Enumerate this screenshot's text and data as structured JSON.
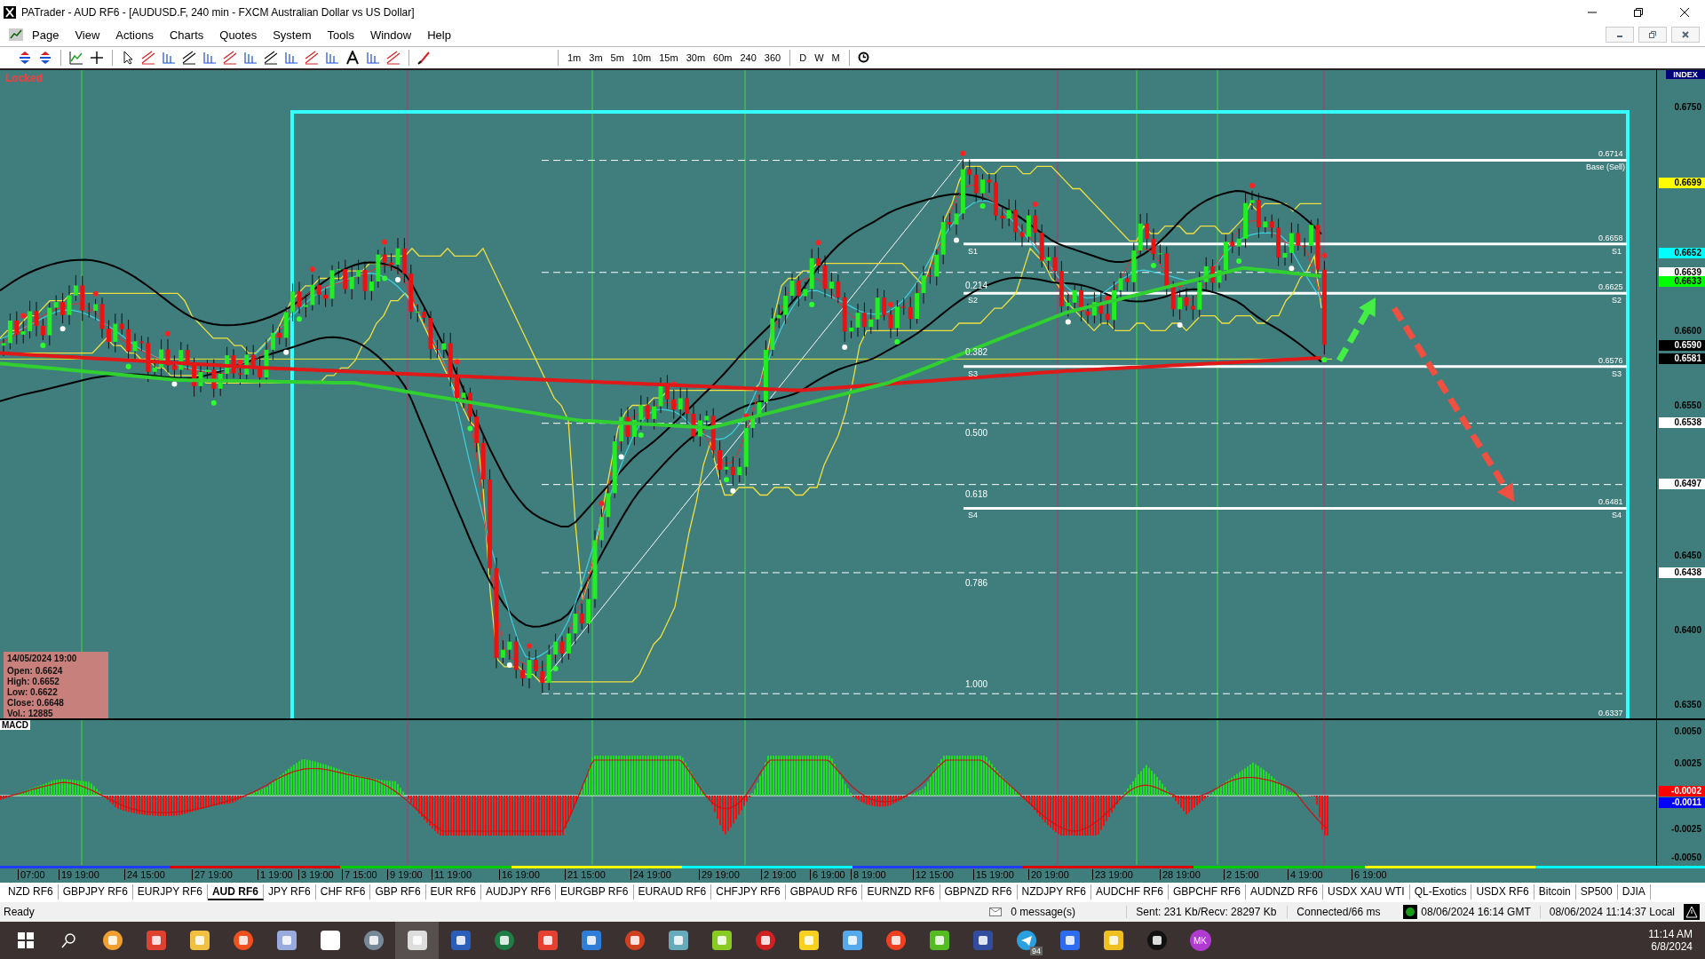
{
  "window": {
    "title": "PATrader - AUD RF6 - [AUDUSD.F, 240 min - FXCM Australian Dollar vs US Dollar]"
  },
  "menu": [
    "Page",
    "View",
    "Actions",
    "Charts",
    "Quotes",
    "System",
    "Tools",
    "Window",
    "Help"
  ],
  "toolbar": {
    "timeframes": [
      "1m",
      "3m",
      "5m",
      "10m",
      "15m",
      "30m",
      "60m",
      "240",
      "360"
    ],
    "periods": [
      "D",
      "W",
      "M"
    ]
  },
  "chart": {
    "status": "Locked",
    "axis_header": "INDEX",
    "price_ticks": [
      "0.6750",
      "0.6600",
      "0.6550",
      "0.6450",
      "0.6400",
      "0.6350"
    ],
    "price_tags": [
      {
        "label": "0.6699",
        "color": "#ffff00"
      },
      {
        "label": "0.6652",
        "color": "#00ffff"
      },
      {
        "label": "0.6639",
        "color": "#ffffff"
      },
      {
        "label": "0.6633",
        "color": "#00ff00"
      },
      {
        "label": "0.6590",
        "color": "#000000"
      },
      {
        "label": "0.6581",
        "color": "#000000"
      },
      {
        "label": "0.6538",
        "color": "#ffffff"
      },
      {
        "label": "0.6497",
        "color": "#ffffff"
      },
      {
        "label": "0.6438",
        "color": "#ffffff"
      }
    ],
    "fib_labels": [
      "0.214",
      "0.382",
      "0.500",
      "0.618",
      "0.786",
      "1.000"
    ],
    "level_labels": [
      "0.6714",
      "Base (Sell)",
      "0.6658",
      "S1",
      "S1",
      "0.6625",
      "S2",
      "S2",
      "0.6576",
      "S3",
      "S3",
      "0.6481",
      "S4",
      "S4",
      "0.6337"
    ],
    "info": {
      "date": "14/05/2024 19:00",
      "lines": [
        "Open: 0.6624",
        "High: 0.6652",
        "Low: 0.6622",
        "Close: 0.6648",
        "Vol.: 12885"
      ]
    }
  },
  "macd": {
    "label": "MACD",
    "ticks": [
      "0.0050",
      "0.0025",
      "-0.0025",
      "-0.0050"
    ],
    "tags": [
      {
        "label": "-0.0002",
        "color": "#ff0000"
      },
      {
        "label": "-0.0011",
        "color": "#0000ff"
      }
    ]
  },
  "time_axis": [
    "07:00",
    "19 19:00",
    "24 15:00",
    "27 19:00",
    "1 19:00",
    "3 19:00",
    "7 15:00",
    "9 19:00",
    "11 19:00",
    "16 19:00",
    "21 15:00",
    "24 19:00",
    "29 19:00",
    "2 19:00",
    "6 19:00",
    "8 19:00",
    "12 15:00",
    "15 19:00",
    "20 19:00",
    "23 19:00",
    "28 19:00",
    "2 15:00",
    "4 19:00",
    "6 19:00"
  ],
  "tabs": [
    {
      "label": "NZD RF6",
      "selected": false
    },
    {
      "label": "GBPJPY RF6",
      "selected": false
    },
    {
      "label": "EURJPY RF6",
      "selected": false
    },
    {
      "label": "AUD RF6",
      "selected": true
    },
    {
      "label": "JPY RF6",
      "selected": false
    },
    {
      "label": "CHF RF6",
      "selected": false
    },
    {
      "label": "GBP RF6",
      "selected": false
    },
    {
      "label": "EUR RF6",
      "selected": false
    },
    {
      "label": "AUDJPY RF6",
      "selected": false
    },
    {
      "label": "EURGBP RF6",
      "selected": false
    },
    {
      "label": "EURAUD RF6",
      "selected": false
    },
    {
      "label": "CHFJPY RF6",
      "selected": false
    },
    {
      "label": "GBPAUD RF6",
      "selected": false
    },
    {
      "label": "EURNZD RF6",
      "selected": false
    },
    {
      "label": "GBPNZD RF6",
      "selected": false
    },
    {
      "label": "NZDJPY RF6",
      "selected": false
    },
    {
      "label": "AUDCHF RF6",
      "selected": false
    },
    {
      "label": "GBPCHF RF6",
      "selected": false
    },
    {
      "label": "AUDNZD RF6",
      "selected": false
    },
    {
      "label": "USDX XAU WTI",
      "selected": false
    },
    {
      "label": "QL-Exotics",
      "selected": false
    },
    {
      "label": "USDX RF6",
      "selected": false
    },
    {
      "label": "Bitcoin",
      "selected": false
    },
    {
      "label": "SP500",
      "selected": false
    },
    {
      "label": "DJIA",
      "selected": false
    }
  ],
  "status_bar": {
    "state": "Ready",
    "messages": "0 message(s)",
    "traffic": "Sent: 231 Kb/Recv: 28297 Kb",
    "connection": "Connected/66 ms",
    "server_time": "08/06/2024 16:14 GMT",
    "local_time": "08/06/2024 11:14:37 Local"
  },
  "taskbar": {
    "telegram_badge": "94",
    "avatar": "MK",
    "time": "11:14 AM",
    "date": "6/8/2024"
  }
}
